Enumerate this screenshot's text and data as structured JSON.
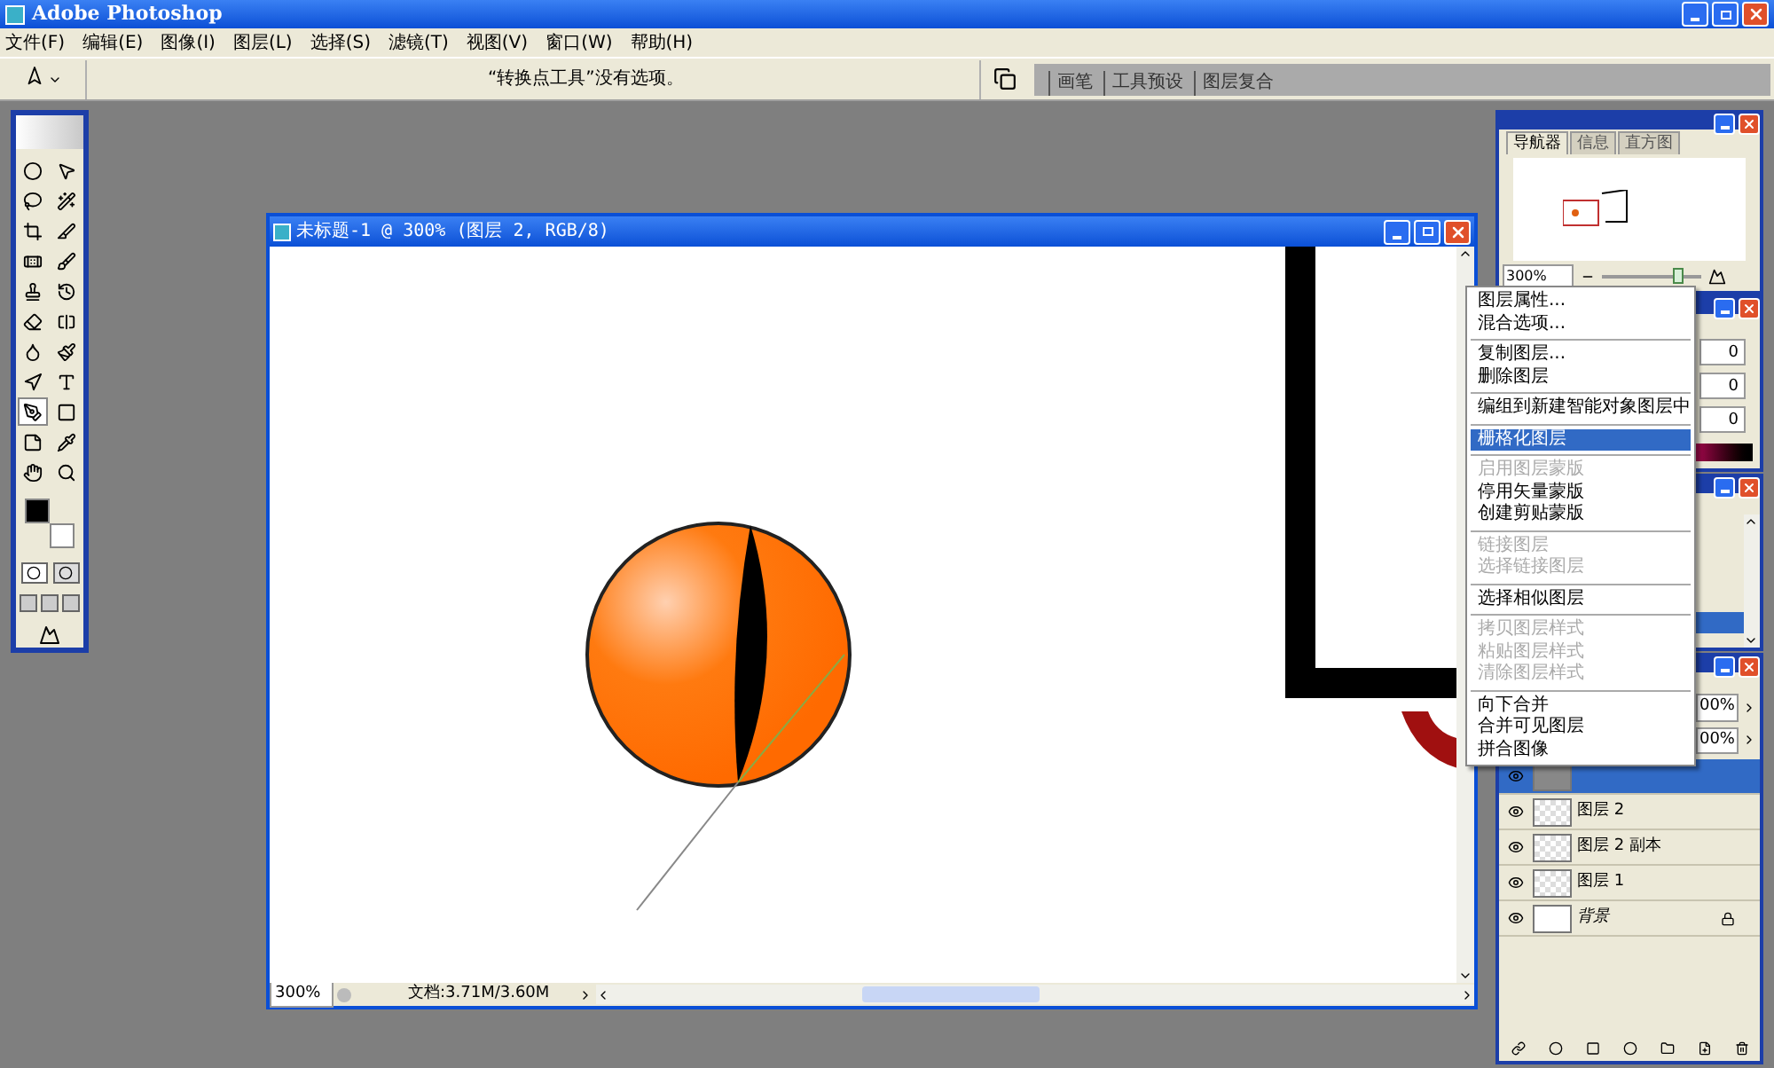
{
  "app": {
    "title": "Adobe Photoshop"
  },
  "menu": [
    "文件(F)",
    "编辑(E)",
    "图像(I)",
    "图层(L)",
    "选择(S)",
    "滤镜(T)",
    "视图(V)",
    "窗口(W)",
    "帮助(H)"
  ],
  "options_bar": {
    "message": "“转换点工具”没有选项。",
    "palette_tabs": [
      "画笔",
      "工具预设",
      "图层复合"
    ]
  },
  "document": {
    "title": "未标题-1 @ 300% (图层 2, RGB/8)",
    "zoom": "300%",
    "status": "文档:3.71M/3.60M"
  },
  "navigator": {
    "tabs": [
      {
        "label": "导航器",
        "selected": true
      },
      {
        "label": "信息",
        "selected": false
      },
      {
        "label": "直方图",
        "selected": false
      }
    ],
    "zoom": "300%",
    "level": 0.72
  },
  "color_panel": {
    "values": [
      "0",
      "0",
      "0"
    ]
  },
  "layers_panel": {
    "opacity": "00%",
    "fill": "00%",
    "layers": [
      {
        "selected": true,
        "visible": true,
        "kind": "shape"
      },
      {
        "name": "图层 2",
        "selected": false,
        "visible": true,
        "kind": "transparent"
      },
      {
        "name": "图层 2 副本",
        "selected": false,
        "visible": true,
        "kind": "transparent"
      },
      {
        "name": "图层 1",
        "selected": false,
        "visible": true,
        "kind": "transparent"
      },
      {
        "name": "背景",
        "selected": false,
        "visible": true,
        "kind": "background",
        "locked": true
      }
    ]
  },
  "context_menu": {
    "groups": [
      [
        {
          "label": "图层属性...",
          "disabled": false,
          "selected": false
        },
        {
          "label": "混合选项...",
          "disabled": false,
          "selected": false
        }
      ],
      [
        {
          "label": "复制图层...",
          "disabled": false,
          "selected": false
        },
        {
          "label": "删除图层",
          "disabled": false,
          "selected": false
        }
      ],
      [
        {
          "label": "编组到新建智能对象图层中",
          "disabled": false,
          "selected": false
        }
      ],
      [
        {
          "label": "栅格化图层",
          "disabled": false,
          "selected": true
        }
      ],
      [
        {
          "label": "启用图层蒙版",
          "disabled": true,
          "selected": false
        },
        {
          "label": "停用矢量蒙版",
          "disabled": false,
          "selected": false
        },
        {
          "label": "创建剪贴蒙版",
          "disabled": false,
          "selected": false
        }
      ],
      [
        {
          "label": "链接图层",
          "disabled": true,
          "selected": false
        },
        {
          "label": "选择链接图层",
          "disabled": true,
          "selected": false
        }
      ],
      [
        {
          "label": "选择相似图层",
          "disabled": false,
          "selected": false
        }
      ],
      [
        {
          "label": "拷贝图层样式",
          "disabled": true,
          "selected": false
        },
        {
          "label": "粘贴图层样式",
          "disabled": true,
          "selected": false
        },
        {
          "label": "清除图层样式",
          "disabled": true,
          "selected": false
        }
      ],
      [
        {
          "label": "向下合并",
          "disabled": false,
          "selected": false
        },
        {
          "label": "合并可见图层",
          "disabled": false,
          "selected": false
        },
        {
          "label": "拼合图像",
          "disabled": false,
          "selected": false
        }
      ]
    ]
  }
}
